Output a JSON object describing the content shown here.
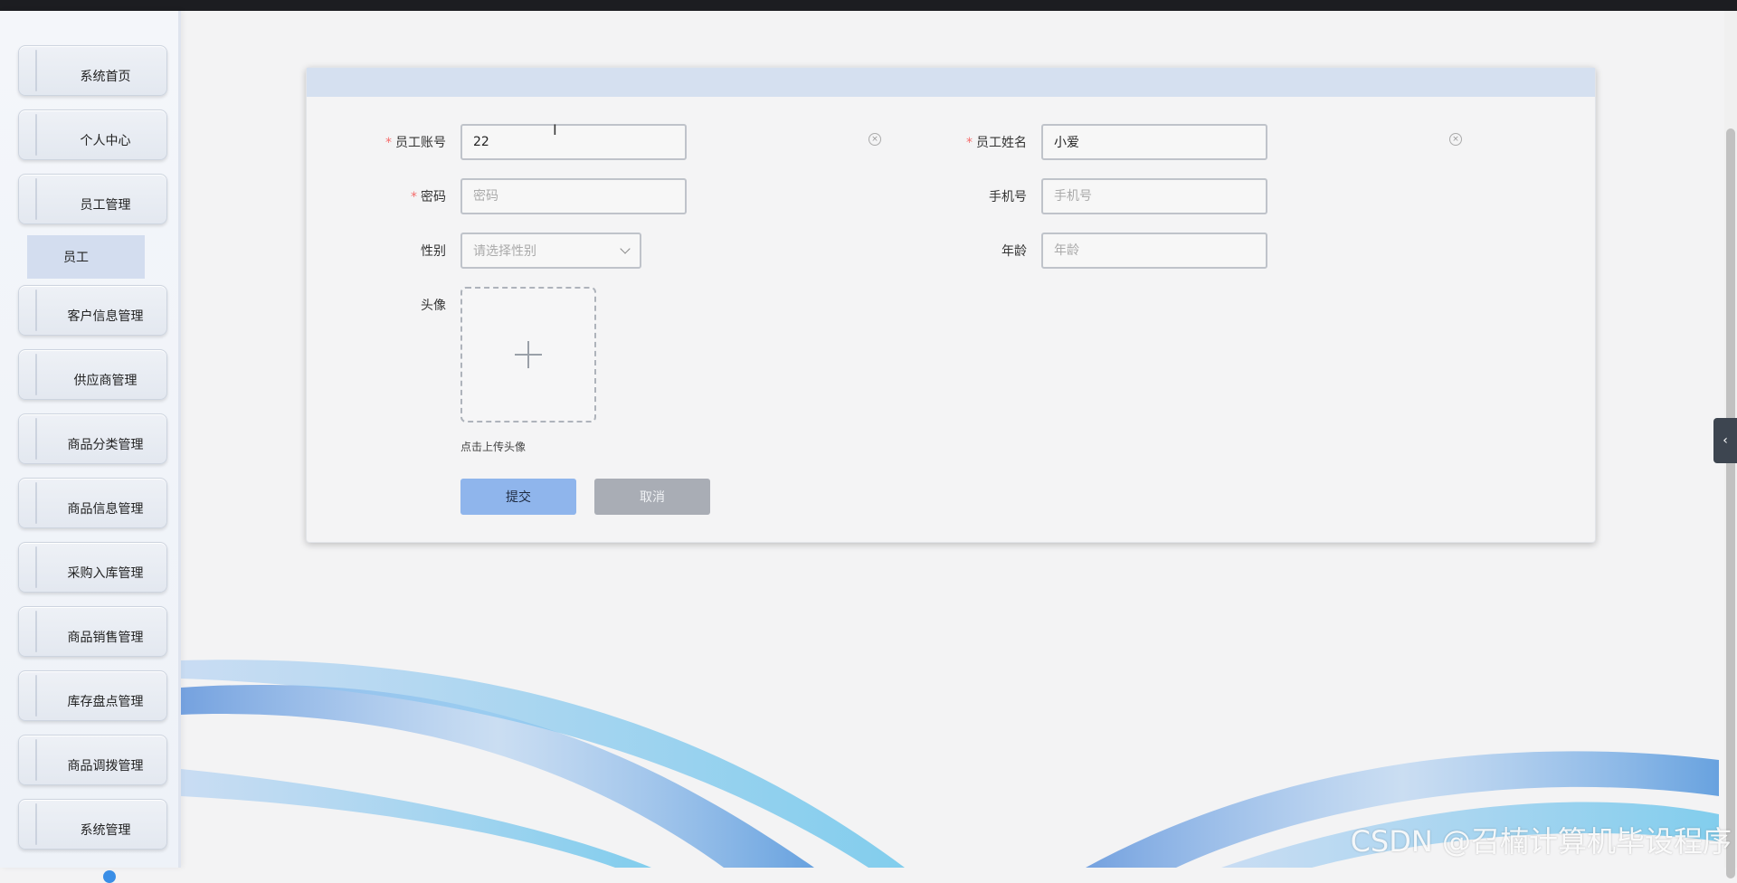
{
  "sidebar": {
    "items": [
      {
        "label": "系统首页"
      },
      {
        "label": "个人中心"
      },
      {
        "label": "员工管理"
      },
      {
        "label": "客户信息管理"
      },
      {
        "label": "供应商管理"
      },
      {
        "label": "商品分类管理"
      },
      {
        "label": "商品信息管理"
      },
      {
        "label": "采购入库管理"
      },
      {
        "label": "商品销售管理"
      },
      {
        "label": "库存盘点管理"
      },
      {
        "label": "商品调拨管理"
      },
      {
        "label": "系统管理"
      }
    ],
    "submenu_active": "员工"
  },
  "form": {
    "account": {
      "label": "员工账号",
      "value": "22",
      "placeholder": "员工账号"
    },
    "name": {
      "label": "员工姓名",
      "value": "小爱",
      "placeholder": "员工姓名"
    },
    "password": {
      "label": "密码",
      "value": "",
      "placeholder": "密码"
    },
    "phone": {
      "label": "手机号",
      "value": "",
      "placeholder": "手机号"
    },
    "gender": {
      "label": "性别",
      "placeholder": "请选择性别"
    },
    "age": {
      "label": "年龄",
      "value": "",
      "placeholder": "年龄"
    },
    "avatar": {
      "label": "头像",
      "tip": "点击上传头像"
    },
    "submit_label": "提交",
    "cancel_label": "取消"
  },
  "watermark": "CSDN @召楠计算机毕设程序",
  "colors": {
    "accent": "#8fb5ec",
    "required": "#f56c6c",
    "header": "#d5e0f0"
  }
}
